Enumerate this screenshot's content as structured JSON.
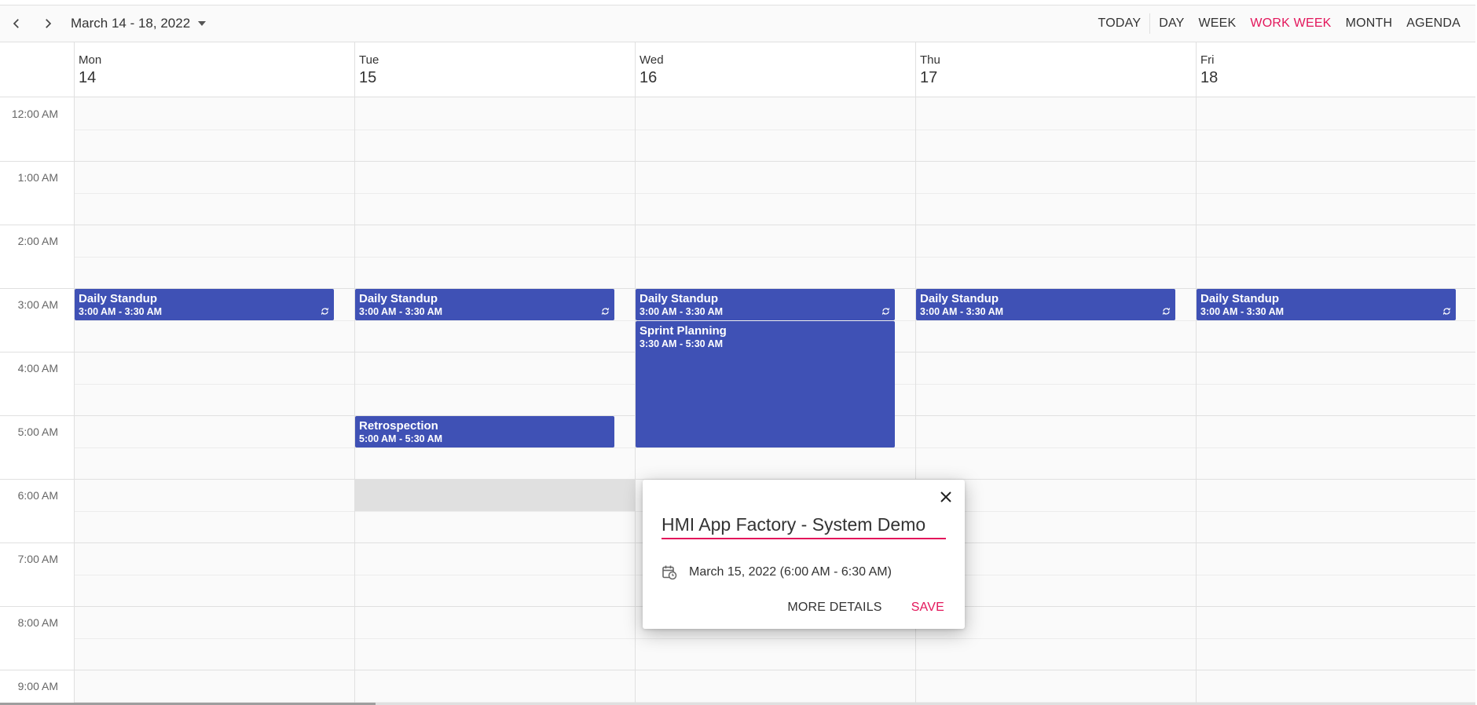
{
  "toolbar": {
    "prev_icon": "chevron-left-icon",
    "next_icon": "chevron-right-icon",
    "date_range": "March 14 - 18, 2022",
    "views": [
      "TODAY",
      "DAY",
      "WEEK",
      "WORK WEEK",
      "MONTH",
      "AGENDA"
    ],
    "active_view": "WORK WEEK",
    "active_color": "#e3165b"
  },
  "days": [
    {
      "name": "Mon",
      "num": "14"
    },
    {
      "name": "Tue",
      "num": "15"
    },
    {
      "name": "Wed",
      "num": "16"
    },
    {
      "name": "Thu",
      "num": "17"
    },
    {
      "name": "Fri",
      "num": "18"
    }
  ],
  "times": [
    "12:00 AM",
    "1:00 AM",
    "2:00 AM",
    "3:00 AM",
    "4:00 AM",
    "5:00 AM",
    "6:00 AM",
    "7:00 AM",
    "8:00 AM",
    "9:00 AM"
  ],
  "events": [
    {
      "day": 0,
      "title": "Daily Standup",
      "time": "3:00 AM - 3:30 AM",
      "start": 3,
      "end": 3.5,
      "recurring": true
    },
    {
      "day": 1,
      "title": "Daily Standup",
      "time": "3:00 AM - 3:30 AM",
      "start": 3,
      "end": 3.5,
      "recurring": true
    },
    {
      "day": 2,
      "title": "Daily Standup",
      "time": "3:00 AM - 3:30 AM",
      "start": 3,
      "end": 3.5,
      "recurring": true
    },
    {
      "day": 3,
      "title": "Daily Standup",
      "time": "3:00 AM - 3:30 AM",
      "start": 3,
      "end": 3.5,
      "recurring": true
    },
    {
      "day": 4,
      "title": "Daily Standup",
      "time": "3:00 AM - 3:30 AM",
      "start": 3,
      "end": 3.5,
      "recurring": true
    },
    {
      "day": 2,
      "title": "Sprint Planning",
      "time": "3:30 AM - 5:30 AM",
      "start": 3.5,
      "end": 5.5,
      "recurring": false
    },
    {
      "day": 1,
      "title": "Retrospection",
      "time": "5:00 AM - 5:30 AM",
      "start": 5,
      "end": 5.5,
      "recurring": false
    }
  ],
  "event_color": "#3f51b5",
  "selected_slot": {
    "day": 1,
    "start": 6,
    "end": 6.5
  },
  "popup": {
    "subject": "HMI App Factory - System Demo",
    "date_text": "March 15, 2022 (6:00 AM - 6:30 AM)",
    "more_details_label": "MORE DETAILS",
    "save_label": "SAVE",
    "close_icon": "close-icon",
    "date_icon": "calendar-clock-icon"
  }
}
